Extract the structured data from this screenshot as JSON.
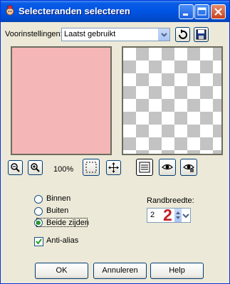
{
  "window": {
    "title": "Selecteranden selecteren"
  },
  "presets": {
    "label": "Voorinstellingen:",
    "value": "Laatst gebruikt"
  },
  "zoom": {
    "value": "100%"
  },
  "selection_type": {
    "options": [
      "Binnen",
      "Buiten",
      "Beide zijden"
    ],
    "selected": "Beide zijden"
  },
  "border_width": {
    "label": "Randbreedte:",
    "value": "2",
    "annotation": "2"
  },
  "anti_alias": {
    "label": "Anti-alias",
    "checked": true
  },
  "buttons": {
    "ok": "OK",
    "cancel": "Annuleren",
    "help": "Help"
  },
  "colors": {
    "preview_fill": "#f4b6b6",
    "title_bar": "#0054e3",
    "annotation": "#c0202a"
  }
}
